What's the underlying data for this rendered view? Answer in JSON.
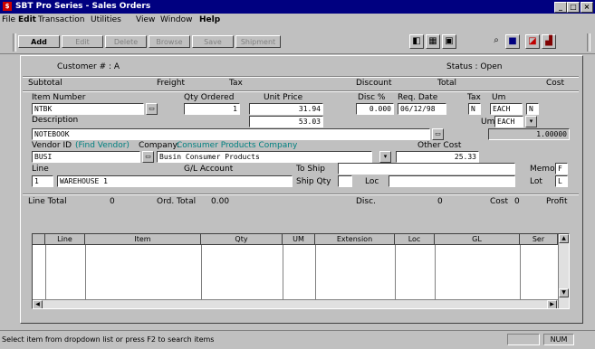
{
  "window": {
    "title": "SBT Pro Series - Sales Orders",
    "controls": [
      "_",
      "□",
      "×"
    ]
  },
  "menu": [
    "File",
    "Edit",
    "Transaction",
    "Utilities",
    "View",
    "Window",
    "Help"
  ],
  "toolbar": {
    "buttons": [
      "Add",
      "Edit",
      "Delete",
      "Browse",
      "Save",
      "Shipment"
    ],
    "icons": [
      "prev-record-icon",
      "next-record-icon",
      "view-icon",
      "search-icon",
      "save-icon",
      "print-icon",
      "chart-icon"
    ]
  },
  "header": {
    "customer_label": "Customer # : A",
    "status_label": "Status : Open",
    "totals_labels": [
      "Subtotal",
      "Freight",
      "Tax",
      "Discount",
      "Total",
      "Cost"
    ]
  },
  "line_entry": {
    "labels": {
      "item": "Item  Number",
      "qty": "Qty Ordered",
      "price": "Unit Price",
      "disc": "Disc %",
      "req_date": "Req. Date",
      "tax": "Tax",
      "um": "Um",
      "description": "Description",
      "vendor": "Vendor ID",
      "vendor_link": "(Find Vendor)",
      "company": "Company:",
      "company_link": "Consumer Products Company",
      "other_cost": "Other Cost",
      "line": "Line",
      "gl_account": "G/L Account",
      "to_ship": "To Ship",
      "ship_qty": "Ship Qty",
      "loc": "Loc",
      "memo": "Memo",
      "lot": "Lot"
    },
    "values": {
      "item": "NTBK",
      "qty": "1",
      "price": "31.94",
      "disc": "0.000",
      "req_date": "06/12/98",
      "tax": "N",
      "um": "EACH",
      "um_code": "N",
      "unit_cost": "53.03",
      "description": "NOTEBOOK",
      "cost_value": "1.00000",
      "vendor": "BUSI",
      "company_value": "Busin Consumer Products",
      "other_cost": "25.33",
      "line": "1",
      "line_desc": "WAREHOUSE 1",
      "memo_flag": "F",
      "lot_flag": "L"
    }
  },
  "summary": {
    "items": [
      "Line Total",
      "0",
      "Ord. Total",
      "0.00",
      "Disc.",
      "0",
      "Cost",
      "0",
      "Profit"
    ]
  },
  "grid": {
    "columns": [
      "Line",
      "Item",
      "Qty",
      "UM",
      "Extension",
      "Loc",
      "GL",
      "Ser"
    ]
  },
  "statusbar": {
    "message": "Select item from dropdown list or press F2 to search items",
    "panel": "NUM"
  }
}
